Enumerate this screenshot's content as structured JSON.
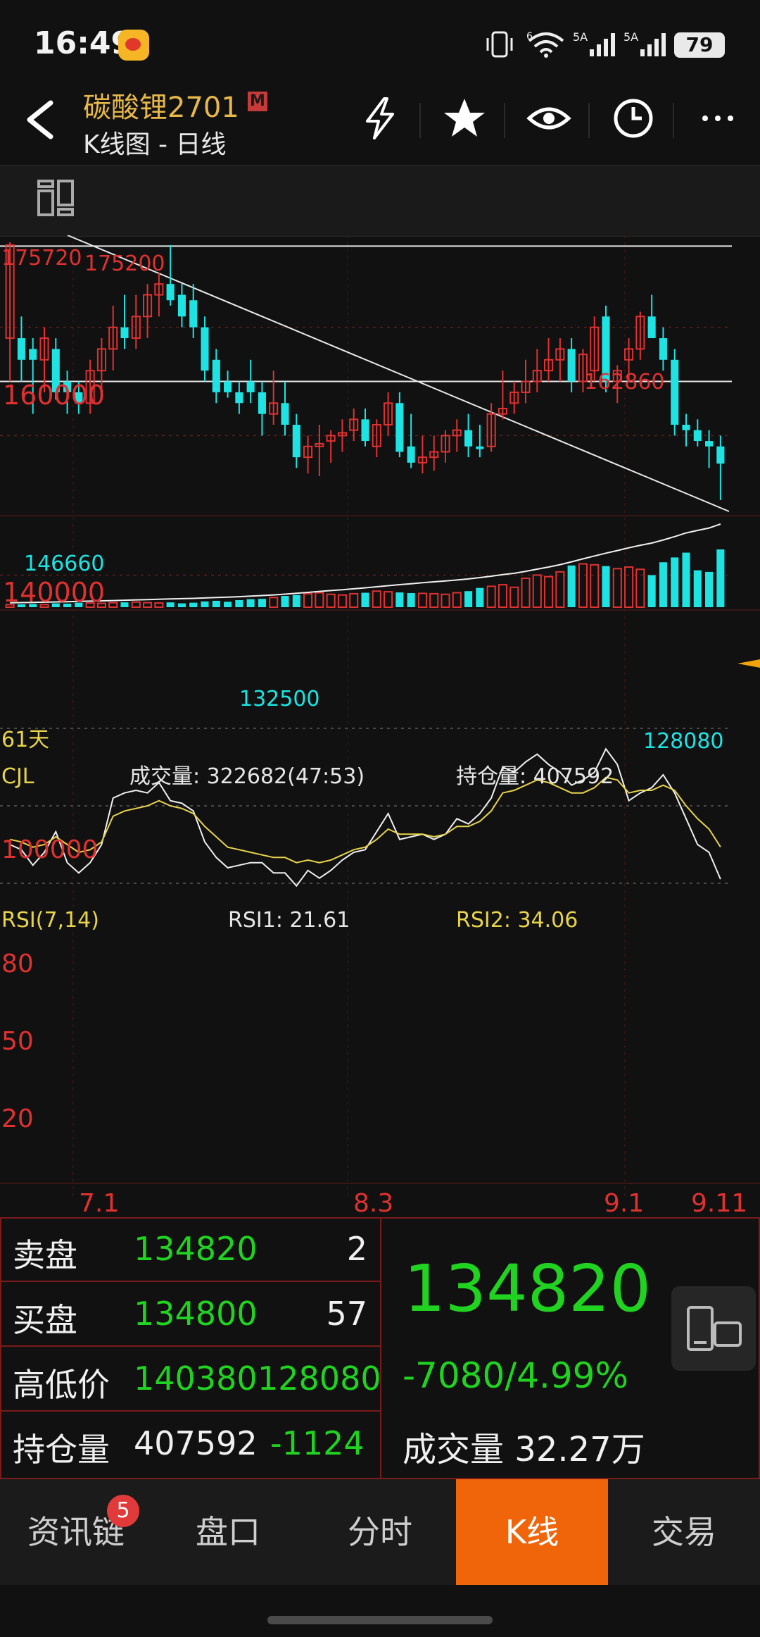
{
  "status_bar": {
    "time": "16:49",
    "battery": "79",
    "network_labels": [
      "6",
      "5A",
      "5A"
    ]
  },
  "header": {
    "title": "碳酸锂2701",
    "badge": "M",
    "subtitle": "K线图 - 日线"
  },
  "chart_data": [
    {
      "type": "candlestick",
      "title": "",
      "period_label": "61天",
      "price_labels": {
        "max_left": "175720",
        "max": "175200",
        "mid_high": "162860",
        "low1": "146660",
        "low2": "132500",
        "low3": "128080"
      },
      "y_ticks": [
        {
          "value": 160000,
          "label": "160000"
        },
        {
          "value": 140000,
          "label": "140000"
        }
      ],
      "ylim": [
        126000,
        177000
      ],
      "x_labels": [
        "7.1",
        "8.3",
        "9.1",
        "9.11"
      ],
      "candles": [
        [
          158000,
          175720,
          150000,
          175200
        ],
        [
          158000,
          162000,
          150000,
          154000
        ],
        [
          156000,
          158000,
          144000,
          154000
        ],
        [
          154000,
          160000,
          148000,
          158000
        ],
        [
          156000,
          158000,
          146660,
          148000
        ],
        [
          150000,
          152000,
          144000,
          148000
        ],
        [
          148000,
          150000,
          144000,
          146000
        ],
        [
          146000,
          154000,
          144000,
          152000
        ],
        [
          152000,
          158000,
          148000,
          156000
        ],
        [
          156000,
          164000,
          152000,
          160000
        ],
        [
          160000,
          166000,
          156000,
          158000
        ],
        [
          158000,
          166000,
          156000,
          162000
        ],
        [
          162000,
          168000,
          158000,
          166000
        ],
        [
          166000,
          170000,
          162000,
          168000
        ],
        [
          168000,
          175200,
          164000,
          165000
        ],
        [
          166000,
          168000,
          160000,
          162000
        ],
        [
          165000,
          168000,
          158000,
          160000
        ],
        [
          160000,
          162000,
          150000,
          152000
        ],
        [
          154000,
          156000,
          146000,
          148000
        ],
        [
          150000,
          152000,
          147000,
          148000
        ],
        [
          148000,
          150000,
          144000,
          146000
        ],
        [
          150000,
          154000,
          146000,
          148000
        ],
        [
          148000,
          150000,
          140000,
          144000
        ],
        [
          144000,
          152000,
          142000,
          146000
        ],
        [
          146000,
          150000,
          140000,
          142000
        ],
        [
          142000,
          144000,
          134000,
          136000
        ],
        [
          136000,
          140000,
          133000,
          138000
        ],
        [
          138000,
          142000,
          132500,
          138500
        ],
        [
          139000,
          141000,
          135000,
          140000
        ],
        [
          140000,
          143000,
          137000,
          140500
        ],
        [
          141000,
          145000,
          139000,
          143000
        ],
        [
          143000,
          145000,
          138000,
          139000
        ],
        [
          138000,
          143000,
          136000,
          142000
        ],
        [
          142000,
          148000,
          140000,
          146000
        ],
        [
          146000,
          148000,
          136000,
          137000
        ],
        [
          138000,
          144000,
          134000,
          135000
        ],
        [
          135000,
          140000,
          133000,
          136000
        ],
        [
          136000,
          140000,
          133500,
          137000
        ],
        [
          137000,
          141000,
          135000,
          140000
        ],
        [
          140000,
          143000,
          137000,
          141000
        ],
        [
          141000,
          144000,
          136000,
          138000
        ],
        [
          138000,
          142000,
          136000,
          137500
        ],
        [
          138000,
          146000,
          137000,
          144000
        ],
        [
          144000,
          152000,
          143000,
          145000
        ],
        [
          146000,
          150000,
          144000,
          148000
        ],
        [
          148000,
          154000,
          146000,
          150000
        ],
        [
          150000,
          156000,
          148000,
          152000
        ],
        [
          152000,
          158000,
          150000,
          154000
        ],
        [
          154000,
          158000,
          150000,
          156000
        ],
        [
          156000,
          158000,
          148000,
          150000
        ],
        [
          150000,
          156000,
          148000,
          155000
        ],
        [
          152000,
          162000,
          150000,
          160000
        ],
        [
          162000,
          164000,
          148000,
          150000
        ],
        [
          150000,
          153000,
          146000,
          152000
        ],
        [
          154000,
          158000,
          150000,
          156000
        ],
        [
          156000,
          162860,
          154000,
          162000
        ],
        [
          162000,
          166000,
          158000,
          158000
        ],
        [
          158000,
          160000,
          152000,
          154000
        ],
        [
          154000,
          156000,
          140000,
          142000
        ],
        [
          142000,
          144000,
          138000,
          141000
        ],
        [
          141000,
          143000,
          138000,
          139000
        ],
        [
          139000,
          141000,
          134000,
          138000
        ],
        [
          138000,
          140000,
          128080,
          134820
        ]
      ]
    },
    {
      "type": "bar",
      "title": "CJL",
      "labels": {
        "volume": "成交量: 322682(47:53)",
        "open_interest": "持仓量: 407592"
      },
      "y_ticks": [
        {
          "value": 100000,
          "label": "100000"
        }
      ],
      "ylim": [
        0,
        220000
      ],
      "values": [
        8000,
        9000,
        10000,
        8000,
        12000,
        11000,
        14000,
        13000,
        12000,
        14000,
        15000,
        16000,
        14000,
        13000,
        15000,
        12000,
        14000,
        18000,
        20000,
        17000,
        22000,
        25000,
        26000,
        30000,
        35000,
        38000,
        42000,
        45000,
        40000,
        38000,
        42000,
        45000,
        50000,
        48000,
        46000,
        44000,
        43000,
        42000,
        40000,
        45000,
        50000,
        60000,
        65000,
        70000,
        62000,
        90000,
        100000,
        95000,
        110000,
        130000,
        135000,
        132000,
        128000,
        120000,
        125000,
        118000,
        100000,
        140000,
        155000,
        170000,
        115000,
        110000,
        180000
      ]
    },
    {
      "type": "line",
      "title": "RSI(7,14)",
      "labels": {
        "rsi1": "RSI1: 21.61",
        "rsi2": "RSI2: 34.06"
      },
      "y_ticks": [
        {
          "value": 80,
          "label": "80"
        },
        {
          "value": 50,
          "label": "50"
        },
        {
          "value": 20,
          "label": "20"
        }
      ],
      "ylim": [
        0,
        100
      ],
      "series": [
        {
          "values": [
            35,
            33,
            27,
            32,
            40,
            28,
            24,
            28,
            35,
            53,
            55,
            56,
            55,
            59,
            52,
            51,
            48,
            36,
            30,
            26,
            27,
            28,
            28,
            24,
            24,
            19,
            25,
            22,
            25,
            29,
            32,
            33,
            40,
            47,
            37,
            38,
            39,
            37,
            39,
            45,
            43,
            47,
            53,
            65,
            63,
            67,
            70,
            66,
            63,
            58,
            60,
            63,
            72,
            66,
            52,
            55,
            57,
            62,
            55,
            45,
            35,
            32,
            21.61
          ]
        },
        {
          "values": [
            37,
            36,
            34,
            35,
            38,
            35,
            32,
            33,
            36,
            46,
            48,
            49,
            50,
            52,
            50,
            49,
            47,
            42,
            38,
            34,
            33,
            32,
            31,
            30,
            30,
            28,
            29,
            28,
            29,
            31,
            33,
            34,
            37,
            41,
            39,
            39,
            39,
            38,
            39,
            42,
            42,
            44,
            48,
            55,
            56,
            58,
            60,
            59,
            57,
            55,
            55,
            57,
            61,
            60,
            55,
            56,
            56,
            58,
            56,
            50,
            45,
            41,
            34.06
          ]
        }
      ]
    }
  ],
  "quote": {
    "rows": [
      {
        "label": "卖盘",
        "value": "134820",
        "count": "2"
      },
      {
        "label": "买盘",
        "value": "134800",
        "count": "57"
      },
      {
        "label": "高低价",
        "value": "140380",
        "value2": "128080"
      },
      {
        "label": "持仓量",
        "value": "407592",
        "value2": "-1124"
      }
    ],
    "last_price": "134820",
    "change": "-7080/4.99%",
    "volume_label": "成交量",
    "volume_value": "32.27万"
  },
  "nav": {
    "tabs": [
      "资讯链",
      "盘口",
      "分时",
      "K线",
      "交易"
    ],
    "active": "K线",
    "badge": "5"
  },
  "colors": {
    "up": "#e03131",
    "down": "#1de3e3",
    "green": "#21d321",
    "accent": "#f0650a",
    "gold": "#e8b84a"
  }
}
